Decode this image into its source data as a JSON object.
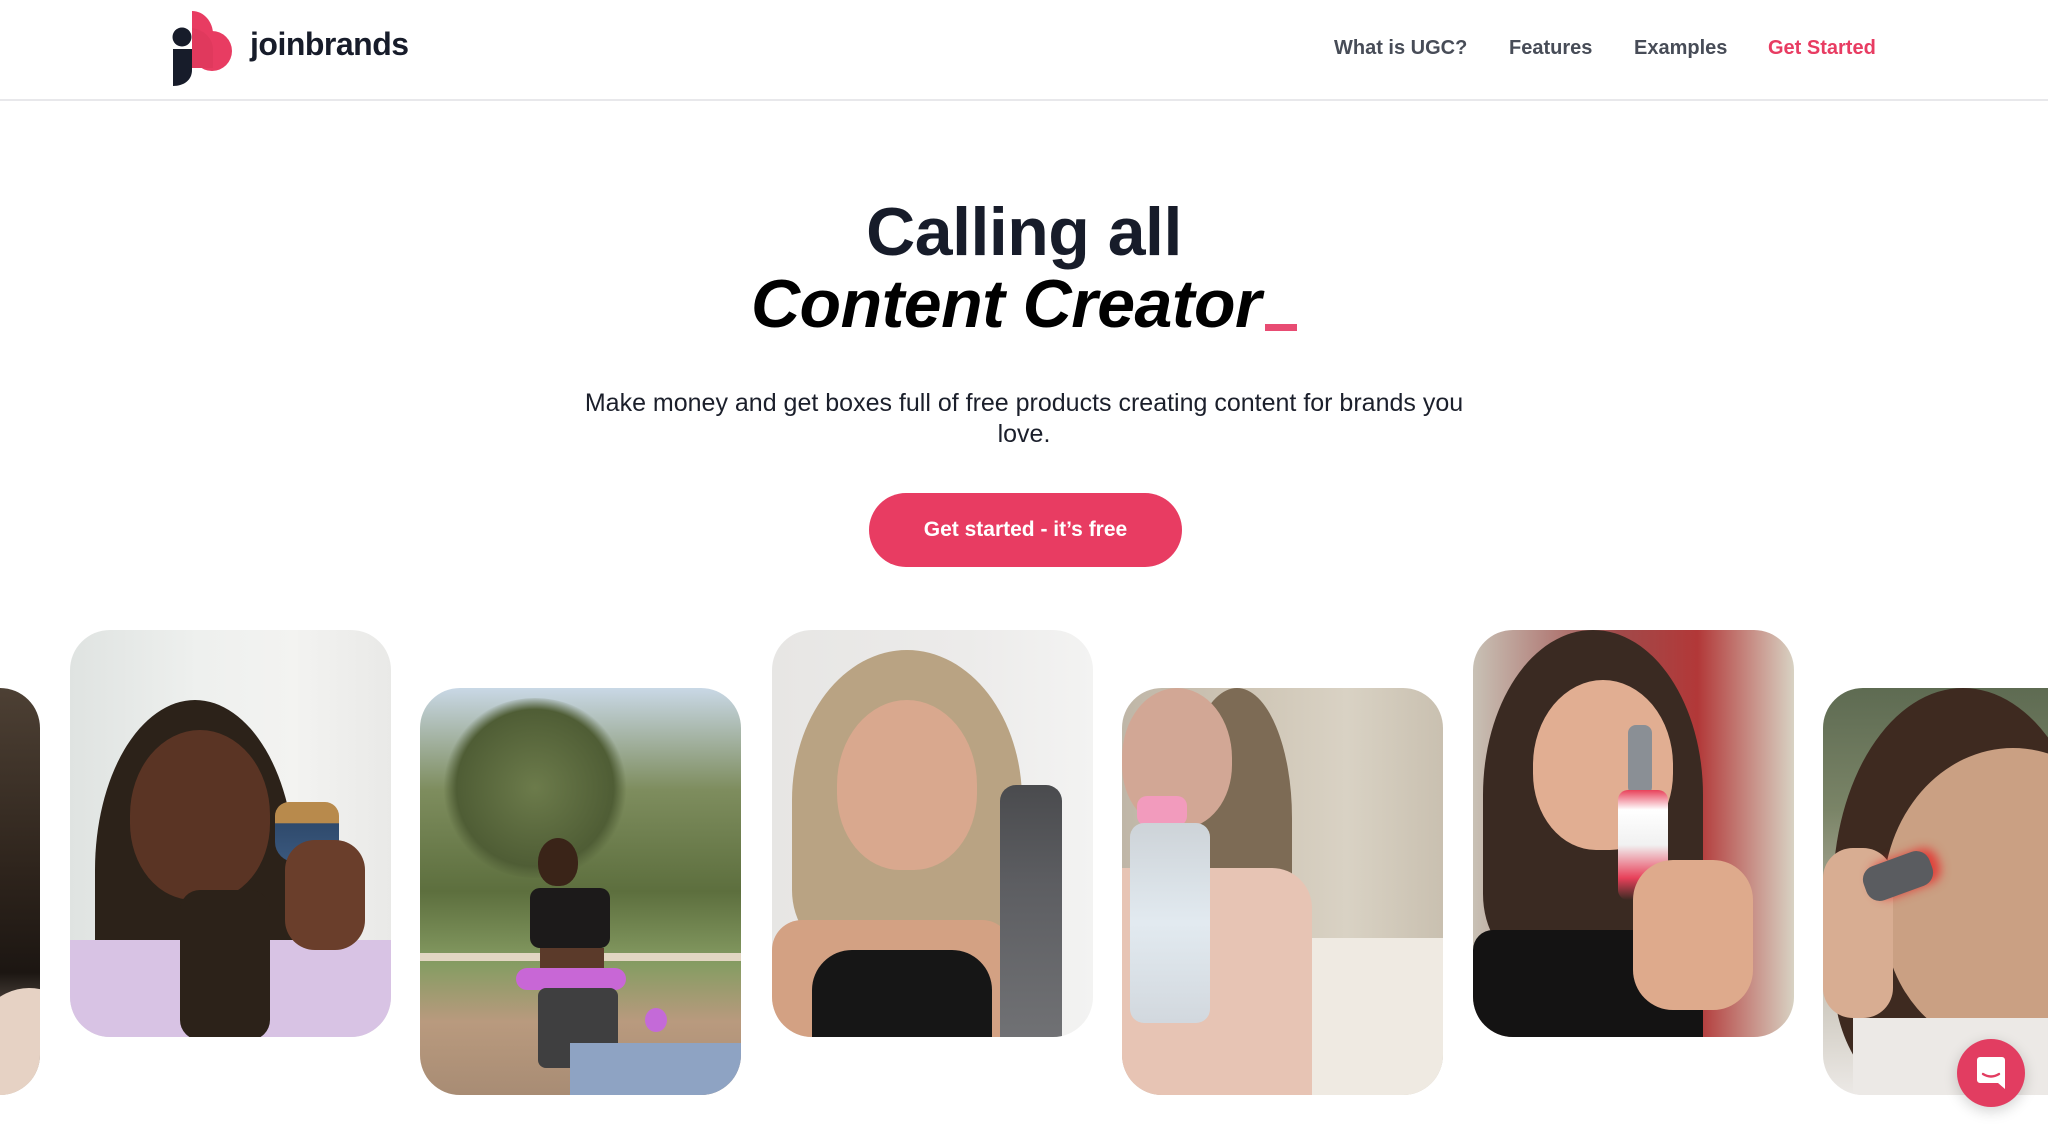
{
  "header": {
    "brand_name": "joinbrands",
    "logo_icon": "joinbrands-logo-icon",
    "nav": [
      {
        "label": "What is UGC?",
        "active": false
      },
      {
        "label": "Features",
        "active": false
      },
      {
        "label": "Examples",
        "active": false
      },
      {
        "label": "Get Started",
        "active": true
      }
    ]
  },
  "hero": {
    "title_line1": "Calling all",
    "title_line2": "Content Creator",
    "cursor_glyph": "_",
    "subtitle": "Make money and get boxes full of free products creating content for brands you love.",
    "cta_label": "Get started - it’s free"
  },
  "carousel": {
    "cards": [
      {
        "description": "creator video (partially visible)"
      },
      {
        "description": "creator smiling holding a makeup brush"
      },
      {
        "description": "creator exercising with a weighted hula hoop outdoors"
      },
      {
        "description": "creator holding a grey water bottle"
      },
      {
        "description": "creator holding a clear bottle with pink cap"
      },
      {
        "description": "creator holding a Lion's Mane tincture bottle"
      },
      {
        "description": "creator using a red-light facial device (partially visible)"
      }
    ]
  },
  "chat": {
    "icon": "chat-icon"
  },
  "colors": {
    "accent": "#e83c62",
    "text_dark": "#171c2a",
    "nav_text": "#474c57",
    "divider": "#e8e8eb"
  }
}
